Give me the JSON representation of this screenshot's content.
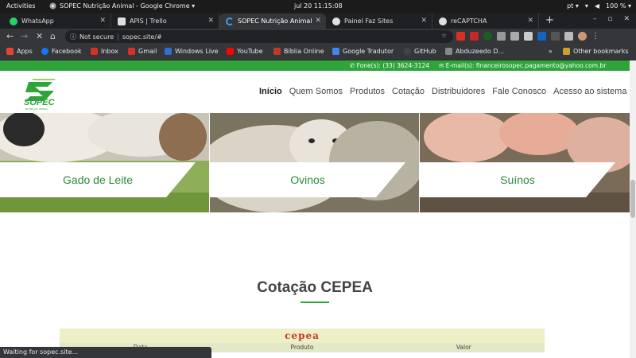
{
  "system_bar": {
    "activities": "Activities",
    "app_title": "SOPEC Nutrição Animal - Google Chrome ▾",
    "clock": "jul 20  11:15:08",
    "lang": "pt ▾",
    "battery": "100 % ▾"
  },
  "tabs": [
    {
      "label": "WhatsApp",
      "color": "#25d366"
    },
    {
      "label": "APIS | Trello",
      "color": "#e0e0e0"
    },
    {
      "label": "SOPEC Nutrição Animal",
      "color": "#3ea0e0"
    },
    {
      "label": "Painel Faz Sites",
      "color": "#e0e0e0"
    },
    {
      "label": "reCAPTCHA",
      "color": "#e0e0e0"
    }
  ],
  "omnibox": {
    "security": "Not secure",
    "url": "sopec.site/#"
  },
  "bookmarks": [
    {
      "label": "Apps",
      "color": "#e94235"
    },
    {
      "label": "Facebook",
      "color": "#1877f2"
    },
    {
      "label": "Inbox",
      "color": "#d93025"
    },
    {
      "label": "Gmail",
      "color": "#d93025"
    },
    {
      "label": "Windows Live",
      "color": "#2e6fd1"
    },
    {
      "label": "YouTube",
      "color": "#ff0000"
    },
    {
      "label": "Bíblia Online",
      "color": "#c0392b"
    },
    {
      "label": "Google Tradutor",
      "color": "#4285f4"
    },
    {
      "label": "GitHub",
      "color": "#444444"
    },
    {
      "label": "Abduzeedo D...",
      "color": "#888888"
    }
  ],
  "other_bookmarks": "Other bookmarks",
  "site": {
    "phone": "Fone(s): (33) 3624-3124",
    "email": "E-mail(s): financeirosopec.pagamento@yahoo.com.br",
    "logo_text": "SOPEC",
    "logo_tagline": "NUTRIÇÃO ANIMAL",
    "menu": [
      "Início",
      "Quem Somos",
      "Produtos",
      "Cotação",
      "Distribuidores",
      "Fale Conosco",
      "Acesso ao sistema"
    ],
    "banners": [
      "Gado de Leite",
      "Ovinos",
      "Suínos"
    ],
    "section_title": "Cotação CEPEA",
    "cepea_logo": "cepea",
    "table_columns": [
      "Data",
      "Produto",
      "Valor"
    ],
    "brand_green": "#2ea43a"
  },
  "status": "Waiting for sopec.site..."
}
